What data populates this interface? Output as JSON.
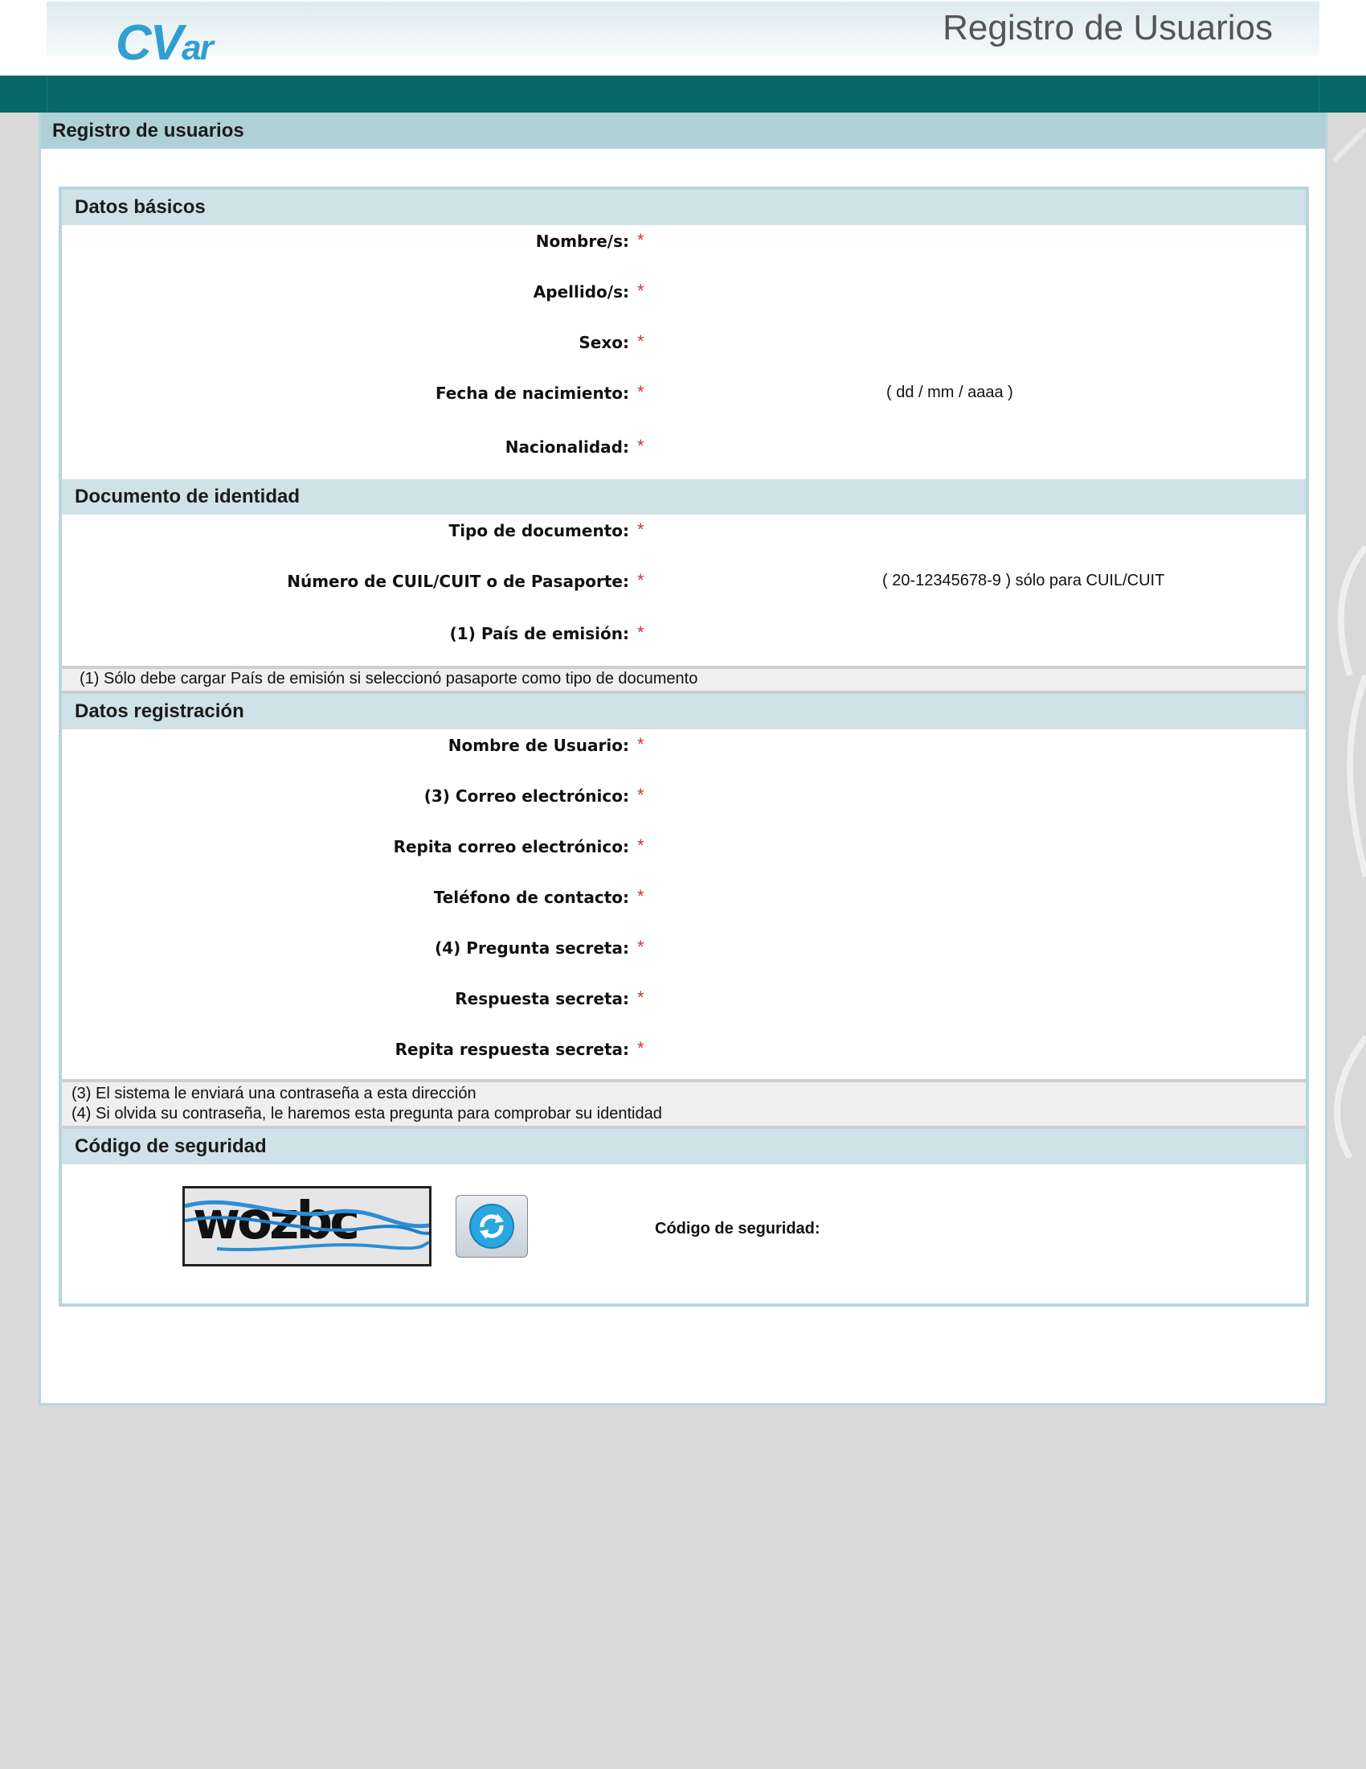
{
  "header": {
    "logo_main": "CV",
    "logo_sub": "ar",
    "app_title": "Registro de Usuarios"
  },
  "card": {
    "title": "Registro de usuarios"
  },
  "required_mark": "*",
  "sections": {
    "basic": {
      "title": "Datos básicos",
      "nombre": "Nombre/s:",
      "apellido": "Apellido/s:",
      "sexo": "Sexo:",
      "fecha": "Fecha de nacimiento:",
      "fecha_hint": "( dd / mm / aaaa )",
      "nacionalidad": "Nacionalidad:"
    },
    "document": {
      "title": "Documento de identidad",
      "tipo": "Tipo de documento:",
      "numero": "Número de CUIL/CUIT o de Pasaporte:",
      "numero_hint": "( 20-12345678-9 ) sólo para CUIL/CUIT",
      "pais": "(1) País de emisión:",
      "note": "(1) Sólo debe cargar País de emisión si seleccionó pasaporte como tipo de documento"
    },
    "registration": {
      "title": "Datos registración",
      "usuario": "Nombre de Usuario:",
      "correo": "(3) Correo electrónico:",
      "repita_correo": "Repita correo electrónico:",
      "telefono": "Teléfono de contacto:",
      "pregunta": "(4) Pregunta secreta:",
      "respuesta": "Respuesta secreta:",
      "repita_respuesta": "Repita respuesta secreta:",
      "note3": "(3) El sistema le enviará una contraseña a esta dirección",
      "note4": "(4) Si olvida su contraseña, le haremos esta pregunta para comprobar su identidad"
    },
    "security": {
      "title": "Código de seguridad",
      "captcha_text": "wozbc",
      "label": "Código de seguridad:"
    }
  },
  "colors": {
    "teal_bar": "#08676a",
    "card_title_bg": "#b0d0d7",
    "section_bg": "#cfe2e7",
    "required": "#d9312f",
    "logo": "#2f9fd0"
  }
}
